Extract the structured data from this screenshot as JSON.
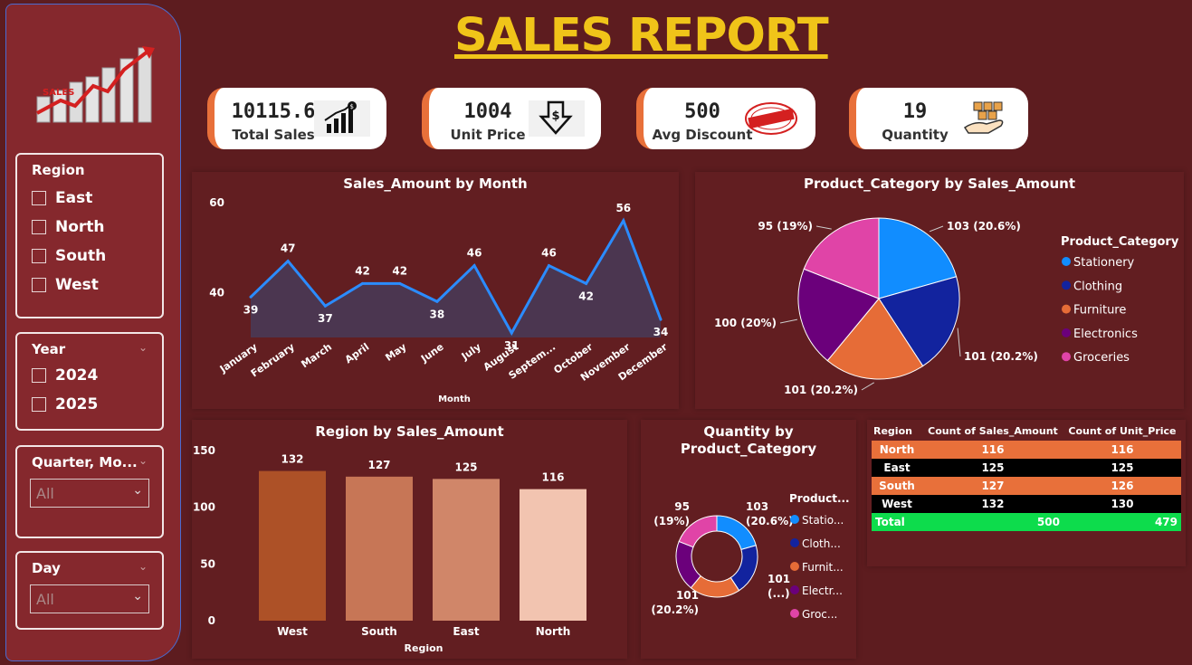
{
  "title": "SALES REPORT",
  "logo_text": "SALES",
  "slicers": {
    "region": {
      "title": "Region",
      "options": [
        "East",
        "North",
        "South",
        "West"
      ]
    },
    "year": {
      "title": "Year",
      "options": [
        "2024",
        "2025"
      ]
    },
    "quarter": {
      "title": "Quarter, Mo...",
      "value": "All"
    },
    "day": {
      "title": "Day",
      "value": "All"
    }
  },
  "kpis": [
    {
      "value": "10115.6",
      "label": "Total Sales",
      "icon": "bar-chart-dollar-icon"
    },
    {
      "value": "1004",
      "label": "Unit Price",
      "icon": "dollar-down-arrow-icon"
    },
    {
      "value": "500",
      "label": "Avg Discount",
      "icon": "discount-stamp-icon"
    },
    {
      "value": "19",
      "label": "Quantity",
      "icon": "boxes-hand-icon"
    }
  ],
  "colors": {
    "stationery": "#118dff",
    "clothing": "#12239e",
    "furniture": "#e66c37",
    "electronics": "#6b007b",
    "groceries": "#e044a7",
    "line": "#2b8cff",
    "accent": "#e8703a",
    "total": "#0ddc4c"
  },
  "chart_data": [
    {
      "type": "area",
      "title": "Sales_Amount by Month",
      "xlabel": "Month",
      "ylabel": "",
      "categories": [
        "January",
        "February",
        "March",
        "April",
        "May",
        "June",
        "July",
        "August",
        "Septem...",
        "October",
        "November",
        "December"
      ],
      "values": [
        39,
        47,
        37,
        42,
        42,
        38,
        46,
        31,
        46,
        42,
        56,
        34
      ],
      "yticks": [
        "40",
        "60"
      ],
      "ylim": [
        30,
        60
      ]
    },
    {
      "type": "pie",
      "title": "Product_Category by Sales_Amount",
      "legend_title": "Product_Category",
      "legend_position": "right",
      "categories": [
        "Stationery",
        "Clothing",
        "Furniture",
        "Electronics",
        "Groceries"
      ],
      "values": [
        103,
        101,
        101,
        100,
        95
      ],
      "labels": [
        "103 (20.6%)",
        "101 (20.2%)",
        "101 (20.2%)",
        "100 (20%)",
        "95 (19%)"
      ]
    },
    {
      "type": "bar",
      "title": "Region by Sales_Amount",
      "xlabel": "Region",
      "ylabel": "",
      "categories": [
        "West",
        "South",
        "East",
        "North"
      ],
      "values": [
        132,
        127,
        125,
        116
      ],
      "bar_colors": [
        "#ad5127",
        "#c77656",
        "#d08669",
        "#f2c4b0"
      ],
      "yticks": [
        "0",
        "50",
        "100",
        "150"
      ],
      "ylim": [
        0,
        150
      ]
    },
    {
      "type": "pie",
      "subtype": "donut",
      "title": "Quantity by Product_Category",
      "legend_title": "Product...",
      "legend_position": "right",
      "categories": [
        "Stationery",
        "Clothing",
        "Furniture",
        "Electronics",
        "Groceries"
      ],
      "legend_labels": [
        "Statio...",
        "Cloth...",
        "Furnit...",
        "Electr...",
        "Groc..."
      ],
      "values": [
        103,
        101,
        101,
        100,
        95
      ],
      "labels": [
        [
          "103",
          "(20.6%)"
        ],
        [
          "101",
          "(...)"
        ],
        [
          "101",
          "(20.2%)"
        ],
        [
          "",
          ""
        ],
        [
          "95",
          "(19%)"
        ]
      ]
    },
    {
      "type": "table",
      "columns": [
        "Region",
        "Count of Sales_Amount",
        "Count of Unit_Price"
      ],
      "rows": [
        [
          "North",
          "116",
          "116"
        ],
        [
          "East",
          "125",
          "125"
        ],
        [
          "South",
          "127",
          "126"
        ],
        [
          "West",
          "132",
          "130"
        ]
      ],
      "total": [
        "Total",
        "500",
        "479"
      ]
    }
  ]
}
